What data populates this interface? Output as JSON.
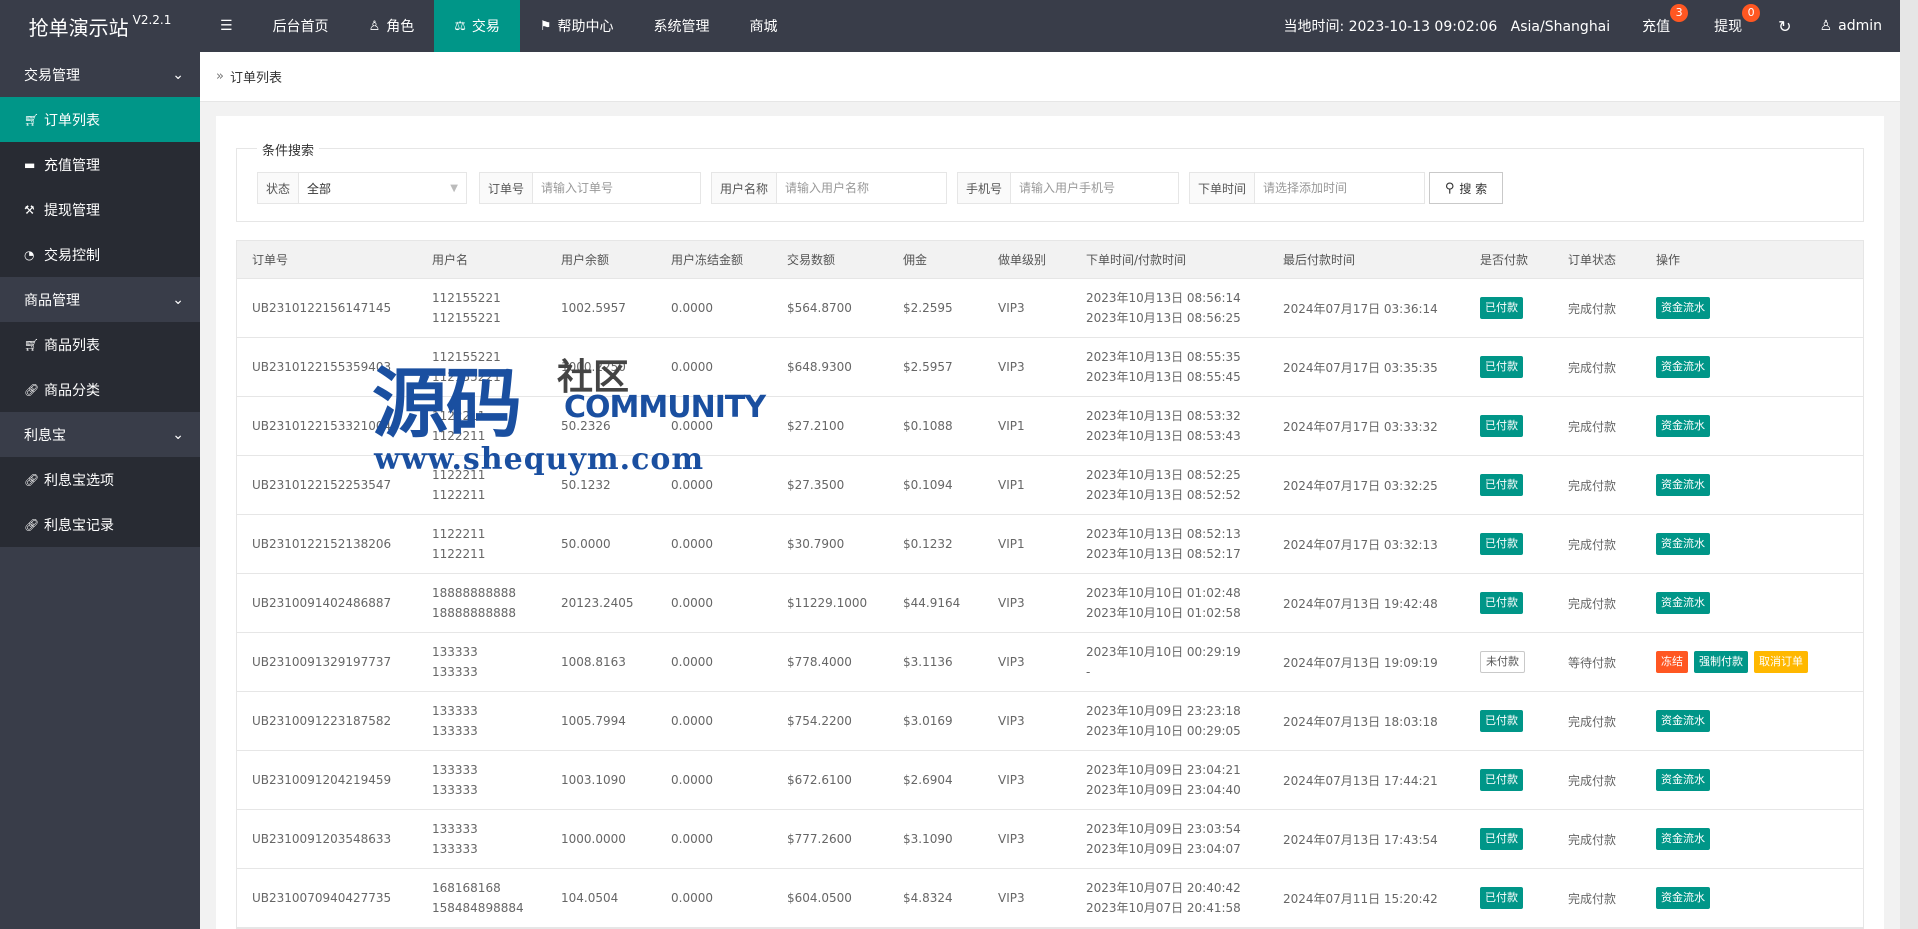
{
  "app": {
    "title": "抢单演示站",
    "version": "V2.2.1"
  },
  "topnav": {
    "menu_icon": "menu-icon",
    "items": [
      {
        "label": "后台首页",
        "icon": ""
      },
      {
        "label": "角色",
        "icon": "user-icon"
      },
      {
        "label": "交易",
        "icon": "scale-icon",
        "active": true
      },
      {
        "label": "帮助中心",
        "icon": "flag-icon"
      },
      {
        "label": "系统管理",
        "icon": ""
      },
      {
        "label": "商城",
        "icon": ""
      }
    ],
    "time_text": "当地时间: 2023-10-13 09:02:06   Asia/Shanghai",
    "recharge": {
      "label": "充值",
      "badge": "3"
    },
    "withdraw": {
      "label": "提现",
      "badge": "0"
    },
    "refresh_icon": "refresh-icon",
    "user": "admin"
  },
  "sidebar": {
    "groups": [
      {
        "label": "交易管理",
        "items": [
          {
            "label": "订单列表",
            "icon": "cart-icon",
            "active": true
          },
          {
            "label": "充值管理",
            "icon": "chat-icon"
          },
          {
            "label": "提现管理",
            "icon": "hammer-icon"
          },
          {
            "label": "交易控制",
            "icon": "gauge-icon"
          }
        ]
      },
      {
        "label": "商品管理",
        "items": [
          {
            "label": "商品列表",
            "icon": "cart-icon"
          },
          {
            "label": "商品分类",
            "icon": "link-icon"
          }
        ]
      },
      {
        "label": "利息宝",
        "items": [
          {
            "label": "利息宝选项",
            "icon": "link-icon"
          },
          {
            "label": "利息宝记录",
            "icon": "link-icon"
          }
        ]
      }
    ]
  },
  "breadcrumb": {
    "label": "订单列表"
  },
  "search": {
    "legend": "条件搜索",
    "status_label": "状态",
    "status_value": "全部",
    "order_label": "订单号",
    "order_placeholder": "请输入订单号",
    "user_label": "用户名称",
    "user_placeholder": "请输入用户名称",
    "phone_label": "手机号",
    "phone_placeholder": "请输入用户手机号",
    "time_label": "下单时间",
    "time_placeholder": "请选择添加时间",
    "button": "搜 索"
  },
  "table": {
    "headers": [
      "订单号",
      "用户名",
      "用户余额",
      "用户冻结金额",
      "交易数额",
      "佣金",
      "做单级别",
      "下单时间/付款时间",
      "最后付款时间",
      "是否付款",
      "订单状态",
      "操作"
    ],
    "rows": [
      {
        "id": "UB2310122156147145",
        "u1": "112155221",
        "u2": "112155221",
        "bal": "1002.5957",
        "frz": "0.0000",
        "amt": "$564.8700",
        "com": "$2.2595",
        "lvl": "VIP3",
        "t1": "2023年10月13日 08:56:14",
        "t2": "2023年10月13日 08:56:25",
        "last": "2024年07月17日 03:36:14",
        "paid": "已付款",
        "status": "完成付款",
        "ops": [
          "资金流水"
        ]
      },
      {
        "id": "UB2310122155359403",
        "u1": "112155221",
        "u2": "112155221",
        "bal": "1000.2250",
        "frz": "0.0000",
        "amt": "$648.9300",
        "com": "$2.5957",
        "lvl": "VIP3",
        "t1": "2023年10月13日 08:55:35",
        "t2": "2023年10月13日 08:55:45",
        "last": "2024年07月17日 03:35:35",
        "paid": "已付款",
        "status": "完成付款",
        "ops": [
          "资金流水"
        ]
      },
      {
        "id": "UB2310122153321004",
        "u1": "1122211",
        "u2": "1122211",
        "bal": "50.2326",
        "frz": "0.0000",
        "amt": "$27.2100",
        "com": "$0.1088",
        "lvl": "VIP1",
        "t1": "2023年10月13日 08:53:32",
        "t2": "2023年10月13日 08:53:43",
        "last": "2024年07月17日 03:33:32",
        "paid": "已付款",
        "status": "完成付款",
        "ops": [
          "资金流水"
        ]
      },
      {
        "id": "UB2310122152253547",
        "u1": "1122211",
        "u2": "1122211",
        "bal": "50.1232",
        "frz": "0.0000",
        "amt": "$27.3500",
        "com": "$0.1094",
        "lvl": "VIP1",
        "t1": "2023年10月13日 08:52:25",
        "t2": "2023年10月13日 08:52:52",
        "last": "2024年07月17日 03:32:25",
        "paid": "已付款",
        "status": "完成付款",
        "ops": [
          "资金流水"
        ]
      },
      {
        "id": "UB2310122152138206",
        "u1": "1122211",
        "u2": "1122211",
        "bal": "50.0000",
        "frz": "0.0000",
        "amt": "$30.7900",
        "com": "$0.1232",
        "lvl": "VIP1",
        "t1": "2023年10月13日 08:52:13",
        "t2": "2023年10月13日 08:52:17",
        "last": "2024年07月17日 03:32:13",
        "paid": "已付款",
        "status": "完成付款",
        "ops": [
          "资金流水"
        ]
      },
      {
        "id": "UB2310091402486887",
        "u1": "18888888888",
        "u2": "18888888888",
        "bal": "20123.2405",
        "frz": "0.0000",
        "amt": "$11229.1000",
        "com": "$44.9164",
        "lvl": "VIP3",
        "t1": "2023年10月10日 01:02:48",
        "t2": "2023年10月10日 01:02:58",
        "last": "2024年07月13日 19:42:48",
        "paid": "已付款",
        "status": "完成付款",
        "ops": [
          "资金流水"
        ]
      },
      {
        "id": "UB2310091329197737",
        "u1": "133333",
        "u2": "133333",
        "bal": "1008.8163",
        "frz": "0.0000",
        "amt": "$778.4000",
        "com": "$3.1136",
        "lvl": "VIP3",
        "t1": "2023年10月10日 00:29:19",
        "t2": "-",
        "last": "2024年07月13日 19:09:19",
        "paid": "未付款",
        "unpaid": true,
        "status": "等待付款",
        "ops": [
          "冻结",
          "强制付款",
          "取消订单"
        ]
      },
      {
        "id": "UB2310091223187582",
        "u1": "133333",
        "u2": "133333",
        "bal": "1005.7994",
        "frz": "0.0000",
        "amt": "$754.2200",
        "com": "$3.0169",
        "lvl": "VIP3",
        "t1": "2023年10月09日 23:23:18",
        "t2": "2023年10月10日 00:29:05",
        "last": "2024年07月13日 18:03:18",
        "paid": "已付款",
        "status": "完成付款",
        "ops": [
          "资金流水"
        ]
      },
      {
        "id": "UB2310091204219459",
        "u1": "133333",
        "u2": "133333",
        "bal": "1003.1090",
        "frz": "0.0000",
        "amt": "$672.6100",
        "com": "$2.6904",
        "lvl": "VIP3",
        "t1": "2023年10月09日 23:04:21",
        "t2": "2023年10月09日 23:04:40",
        "last": "2024年07月13日 17:44:21",
        "paid": "已付款",
        "status": "完成付款",
        "ops": [
          "资金流水"
        ]
      },
      {
        "id": "UB2310091203548633",
        "u1": "133333",
        "u2": "133333",
        "bal": "1000.0000",
        "frz": "0.0000",
        "amt": "$777.2600",
        "com": "$3.1090",
        "lvl": "VIP3",
        "t1": "2023年10月09日 23:03:54",
        "t2": "2023年10月09日 23:04:07",
        "last": "2024年07月13日 17:43:54",
        "paid": "已付款",
        "status": "完成付款",
        "ops": [
          "资金流水"
        ]
      },
      {
        "id": "UB2310070940427735",
        "u1": "168168168",
        "u2": "158484898884",
        "bal": "104.0504",
        "frz": "0.0000",
        "amt": "$604.0500",
        "com": "$4.8324",
        "lvl": "VIP3",
        "t1": "2023年10月07日 20:40:42",
        "t2": "2023年10月07日 20:41:58",
        "last": "2024年07月11日 15:20:42",
        "paid": "已付款",
        "status": "完成付款",
        "ops": [
          "资金流水"
        ]
      }
    ]
  },
  "watermark": {
    "big": "源码",
    "mid": "社区",
    "com": "COMMUNITY",
    "url": "www.shequym.com"
  },
  "colors": {
    "accent": "#009688",
    "header_bg": "#393d49",
    "danger": "#ff5722",
    "warn": "#ffb800"
  }
}
